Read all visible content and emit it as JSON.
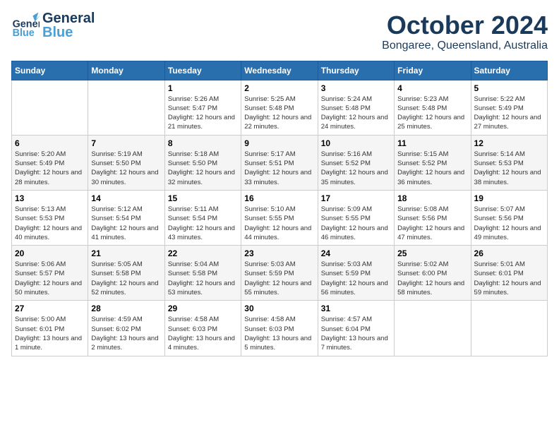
{
  "header": {
    "logo_general": "General",
    "logo_blue": "Blue",
    "month": "October 2024",
    "location": "Bongaree, Queensland, Australia"
  },
  "days_of_week": [
    "Sunday",
    "Monday",
    "Tuesday",
    "Wednesday",
    "Thursday",
    "Friday",
    "Saturday"
  ],
  "weeks": [
    [
      {
        "day": "",
        "detail": ""
      },
      {
        "day": "",
        "detail": ""
      },
      {
        "day": "1",
        "detail": "Sunrise: 5:26 AM\nSunset: 5:47 PM\nDaylight: 12 hours and 21 minutes."
      },
      {
        "day": "2",
        "detail": "Sunrise: 5:25 AM\nSunset: 5:48 PM\nDaylight: 12 hours and 22 minutes."
      },
      {
        "day": "3",
        "detail": "Sunrise: 5:24 AM\nSunset: 5:48 PM\nDaylight: 12 hours and 24 minutes."
      },
      {
        "day": "4",
        "detail": "Sunrise: 5:23 AM\nSunset: 5:48 PM\nDaylight: 12 hours and 25 minutes."
      },
      {
        "day": "5",
        "detail": "Sunrise: 5:22 AM\nSunset: 5:49 PM\nDaylight: 12 hours and 27 minutes."
      }
    ],
    [
      {
        "day": "6",
        "detail": "Sunrise: 5:20 AM\nSunset: 5:49 PM\nDaylight: 12 hours and 28 minutes."
      },
      {
        "day": "7",
        "detail": "Sunrise: 5:19 AM\nSunset: 5:50 PM\nDaylight: 12 hours and 30 minutes."
      },
      {
        "day": "8",
        "detail": "Sunrise: 5:18 AM\nSunset: 5:50 PM\nDaylight: 12 hours and 32 minutes."
      },
      {
        "day": "9",
        "detail": "Sunrise: 5:17 AM\nSunset: 5:51 PM\nDaylight: 12 hours and 33 minutes."
      },
      {
        "day": "10",
        "detail": "Sunrise: 5:16 AM\nSunset: 5:52 PM\nDaylight: 12 hours and 35 minutes."
      },
      {
        "day": "11",
        "detail": "Sunrise: 5:15 AM\nSunset: 5:52 PM\nDaylight: 12 hours and 36 minutes."
      },
      {
        "day": "12",
        "detail": "Sunrise: 5:14 AM\nSunset: 5:53 PM\nDaylight: 12 hours and 38 minutes."
      }
    ],
    [
      {
        "day": "13",
        "detail": "Sunrise: 5:13 AM\nSunset: 5:53 PM\nDaylight: 12 hours and 40 minutes."
      },
      {
        "day": "14",
        "detail": "Sunrise: 5:12 AM\nSunset: 5:54 PM\nDaylight: 12 hours and 41 minutes."
      },
      {
        "day": "15",
        "detail": "Sunrise: 5:11 AM\nSunset: 5:54 PM\nDaylight: 12 hours and 43 minutes."
      },
      {
        "day": "16",
        "detail": "Sunrise: 5:10 AM\nSunset: 5:55 PM\nDaylight: 12 hours and 44 minutes."
      },
      {
        "day": "17",
        "detail": "Sunrise: 5:09 AM\nSunset: 5:55 PM\nDaylight: 12 hours and 46 minutes."
      },
      {
        "day": "18",
        "detail": "Sunrise: 5:08 AM\nSunset: 5:56 PM\nDaylight: 12 hours and 47 minutes."
      },
      {
        "day": "19",
        "detail": "Sunrise: 5:07 AM\nSunset: 5:56 PM\nDaylight: 12 hours and 49 minutes."
      }
    ],
    [
      {
        "day": "20",
        "detail": "Sunrise: 5:06 AM\nSunset: 5:57 PM\nDaylight: 12 hours and 50 minutes."
      },
      {
        "day": "21",
        "detail": "Sunrise: 5:05 AM\nSunset: 5:58 PM\nDaylight: 12 hours and 52 minutes."
      },
      {
        "day": "22",
        "detail": "Sunrise: 5:04 AM\nSunset: 5:58 PM\nDaylight: 12 hours and 53 minutes."
      },
      {
        "day": "23",
        "detail": "Sunrise: 5:03 AM\nSunset: 5:59 PM\nDaylight: 12 hours and 55 minutes."
      },
      {
        "day": "24",
        "detail": "Sunrise: 5:03 AM\nSunset: 5:59 PM\nDaylight: 12 hours and 56 minutes."
      },
      {
        "day": "25",
        "detail": "Sunrise: 5:02 AM\nSunset: 6:00 PM\nDaylight: 12 hours and 58 minutes."
      },
      {
        "day": "26",
        "detail": "Sunrise: 5:01 AM\nSunset: 6:01 PM\nDaylight: 12 hours and 59 minutes."
      }
    ],
    [
      {
        "day": "27",
        "detail": "Sunrise: 5:00 AM\nSunset: 6:01 PM\nDaylight: 13 hours and 1 minute."
      },
      {
        "day": "28",
        "detail": "Sunrise: 4:59 AM\nSunset: 6:02 PM\nDaylight: 13 hours and 2 minutes."
      },
      {
        "day": "29",
        "detail": "Sunrise: 4:58 AM\nSunset: 6:03 PM\nDaylight: 13 hours and 4 minutes."
      },
      {
        "day": "30",
        "detail": "Sunrise: 4:58 AM\nSunset: 6:03 PM\nDaylight: 13 hours and 5 minutes."
      },
      {
        "day": "31",
        "detail": "Sunrise: 4:57 AM\nSunset: 6:04 PM\nDaylight: 13 hours and 7 minutes."
      },
      {
        "day": "",
        "detail": ""
      },
      {
        "day": "",
        "detail": ""
      }
    ]
  ]
}
